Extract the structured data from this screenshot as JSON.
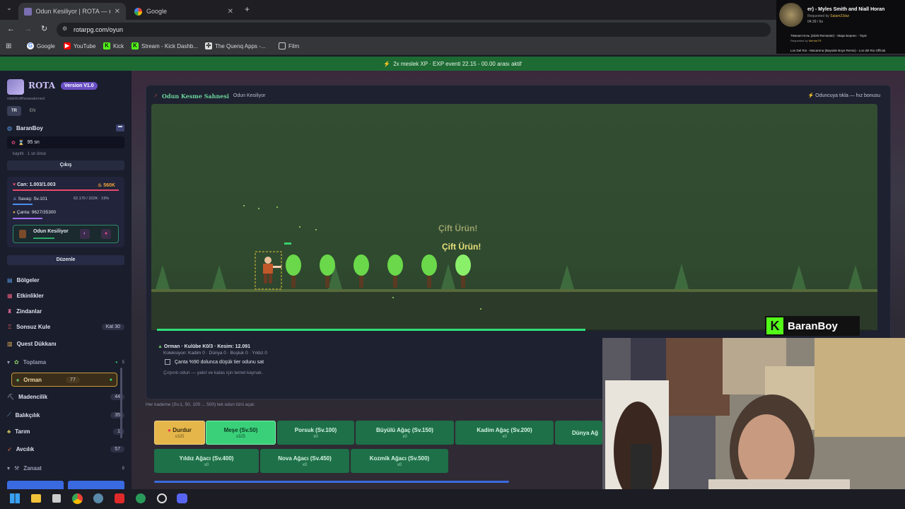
{
  "tabs": [
    {
      "title": "Odun Kesiliyor | ROTA — rot"
    },
    {
      "title": "Google"
    }
  ],
  "address": "rotarpg.com/oyun",
  "bookmarks": [
    "Google",
    "YouTube",
    "Kick",
    "Stream - Kick Dashb...",
    "The Quenq Apps -...",
    "Film"
  ],
  "music": {
    "now": "er) - Myles Smith and Niall Horan",
    "req1": "Requested by",
    "req1_user": "Salam23dur",
    "time": "04:39",
    "count": "6x",
    "q1": "Тёмная Ночь (2026 Remaster) - Марк Бернес - Topic",
    "q1_req": "Requested by",
    "q1_user": "MehtarTR",
    "q2": "Los Del Rio - Macarena (Bayside Boys Remix) - Los del Rio Official"
  },
  "banner": "2x meslek XP · EXP eventi 22.15 - 00.00 arası aktif",
  "sidebar": {
    "brand": "ROTA",
    "version": "Version V1.0",
    "tagline": "rebirthoftheawakened",
    "lang": [
      "TR",
      "EN"
    ],
    "user": "BaranBoy",
    "timer": "95 sn",
    "saved": "kayıtlı · 1 sn önce",
    "logout": "Çıkış",
    "stats": {
      "hp": "Can: 1.003/1.003",
      "gold": "560K",
      "combat": "Savaş: Sv.101",
      "combat_xp": "62.170 / 322K · 19%",
      "bag": "Çanta: 9627/35300"
    },
    "activity": "Odun Kesiliyor",
    "edit": "Düzenle",
    "menu": [
      {
        "label": "Bölgeler",
        "badge": ""
      },
      {
        "label": "Etkinlikler",
        "badge": ""
      },
      {
        "label": "Zindanlar",
        "badge": ""
      },
      {
        "label": "Sonsuz Kule",
        "badge": "Kat 30"
      },
      {
        "label": "Quest Dükkanı",
        "badge": ""
      },
      {
        "label": "Toplama",
        "badge": "5"
      },
      {
        "label": "Orman",
        "badge": "77"
      },
      {
        "label": "Madencilik",
        "badge": "44"
      },
      {
        "label": "Balıkçılık",
        "badge": "35"
      },
      {
        "label": "Tarım",
        "badge": "1"
      },
      {
        "label": "Avcılık",
        "badge": "57"
      },
      {
        "label": "Zanaat",
        "badge": "8"
      }
    ]
  },
  "scene": {
    "title": "Odun Kesme Sahnesi",
    "subtitle": "Odun Kesiliyor",
    "hint": "Oduncuya tıkla — hız bonusu",
    "pop1": "Çift Ürün!",
    "pop2": "Çift Ürün!"
  },
  "info": {
    "line1": "Orman · Kulübe K0/3 · Kesim: 12.091",
    "line2": "Koleksiyon: Kadim 0 · Dünya 0 · Boşluk 0 · Yıldız 0",
    "checkbox": "Çanta %90 dolunca düşük tier odunu sat",
    "desc": "Çırpıntı odun — yakıt ve kalas için temel kaynak.",
    "note": "Her kademe (Sv.1, 50, 100 ... 500) tek odun türü açar."
  },
  "progress": 0.6,
  "buttons": [
    {
      "label": "Durdur",
      "sub": "x325"
    },
    {
      "label": "Meşe (Sv.50)",
      "sub": "x325"
    },
    {
      "label": "Porsuk (Sv.100)",
      "sub": "x0"
    },
    {
      "label": "Büyülü Ağaç (Sv.150)",
      "sub": "x0"
    },
    {
      "label": "Kadim Ağaç (Sv.200)",
      "sub": "x0"
    },
    {
      "label": "Dünya Ağ",
      "sub": ""
    },
    {
      "label": "Yıldız Ağacı (Sv.400)",
      "sub": "x0"
    },
    {
      "label": "Nova Ağacı (Sv.450)",
      "sub": "x0"
    },
    {
      "label": "Kozmik Ağacı (Sv.500)",
      "sub": "x0"
    }
  ],
  "kick_user": "BaranBoy",
  "colors": {
    "accent": "#2ea86a",
    "banner": "#1d6a33",
    "gold": "#f0a23a",
    "stop": "#e5b64a"
  }
}
